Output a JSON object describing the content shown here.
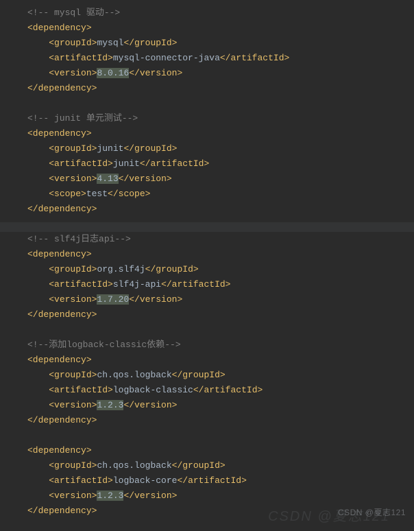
{
  "deps": [
    {
      "comment": "<!-- mysql 驱动-->",
      "groupId": "mysql",
      "artifactId": "mysql-connector-java",
      "version": "8.0.16",
      "scope": null
    },
    {
      "comment": "<!-- junit 单元测试-->",
      "groupId": "junit",
      "artifactId": "junit",
      "version": "4.13",
      "scope": "test"
    },
    {
      "comment": "<!-- slf4j日志api-->",
      "groupId": "org.slf4j",
      "artifactId": "slf4j-api",
      "version": "1.7.20",
      "scope": null
    },
    {
      "comment": "<!--添加logback-classic依赖-->",
      "groupId": "ch.qos.logback",
      "artifactId": "logback-classic",
      "version": "1.2.3",
      "scope": null
    },
    {
      "comment": null,
      "groupId": "ch.qos.logback",
      "artifactId": "logback-core",
      "version": "1.2.3",
      "scope": null
    }
  ],
  "watermark": "CSDN @夏志121",
  "watermark_big": "CSDN @夏志121"
}
